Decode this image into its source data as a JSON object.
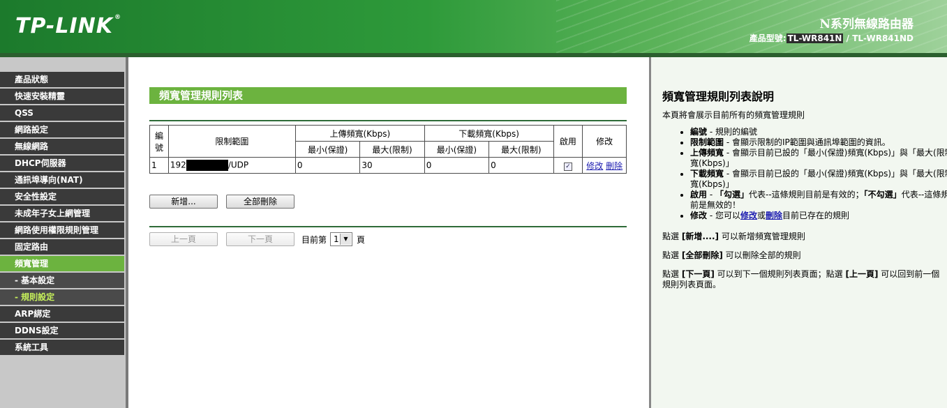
{
  "header": {
    "logo": "TP-LINK",
    "logo_mark": "®",
    "title": "N系列無線路由器",
    "model_label": "產品型號:",
    "model_primary": "TL-WR841N",
    "model_secondary": " / TL-WR841ND"
  },
  "sidebar": {
    "items": [
      {
        "label": "產品狀態"
      },
      {
        "label": "快速安裝精靈"
      },
      {
        "label": "QSS"
      },
      {
        "label": "網路設定"
      },
      {
        "label": "無線網路"
      },
      {
        "label": "DHCP伺服器"
      },
      {
        "label": "通訊埠導向(NAT)"
      },
      {
        "label": "安全性設定"
      },
      {
        "label": "未成年子女上網管理"
      },
      {
        "label": "網路使用權限規則管理"
      },
      {
        "label": "固定路由"
      },
      {
        "label": "頻寬管理"
      },
      {
        "label": "- 基本設定"
      },
      {
        "label": "- 規則設定"
      },
      {
        "label": "ARP綁定"
      },
      {
        "label": "DDNS設定"
      },
      {
        "label": "系統工具"
      }
    ]
  },
  "main": {
    "title": "頻寬管理規則列表",
    "table": {
      "h_no": "編號",
      "h_range": "限制範圍",
      "h_up": "上傳頻寬(Kbps)",
      "h_down": "下載頻寬(Kbps)",
      "h_enable": "啟用",
      "h_modify": "修改",
      "h_min": "最小(保證)",
      "h_max": "最大(限制)",
      "row": {
        "no": "1",
        "range_prefix": "192",
        "range_suffix": "/UDP",
        "up_min": "0",
        "up_max": "30",
        "down_min": "0",
        "down_max": "0",
        "enabled": true,
        "edit": "修改",
        "delete": "刪除"
      }
    },
    "add_button": "新增...",
    "delete_all_button": "全部刪除",
    "prev_button": "上一頁",
    "next_button": "下一頁",
    "page_prefix": "目前第",
    "page_value": "1",
    "page_suffix": "頁"
  },
  "help": {
    "title": "頻寬管理規則列表說明",
    "intro": "本頁將會展示目前所有的頻寬管理規則",
    "items": [
      {
        "term": "編號",
        "desc": " - 規則的編號"
      },
      {
        "term": "限制範圍",
        "desc": " - 會顯示限制的IP範圍與通訊埠範圍的資訊。"
      },
      {
        "term": "上傳頻寬",
        "desc": " - 會顯示目前已設的「最小(保證)頻寬(Kbps)」與「最大(限制)頻寬(Kbps)」"
      },
      {
        "term": "下載頻寬",
        "desc": " - 會顯示目前已設的「最小(保證)頻寬(Kbps)」與「最大(限制)頻寬(Kbps)」"
      }
    ],
    "enable_term": "啟用",
    "enable_desc_a": " - ",
    "enable_checked": "「勾選」",
    "enable_desc_b": "代表--這條規則目前是有效的；",
    "enable_unchecked": "「不勾選」",
    "enable_desc_c": "代表--這條規則目前是無效的！",
    "modify_term": "修改",
    "modify_desc_a": " - 您可以",
    "modify_link1": "修改",
    "modify_or": "或",
    "modify_link2": "刪除",
    "modify_desc_b": "目前已存在的規則",
    "p1_prefix": "點選 ",
    "p1_bold": "[新增....]",
    "p1_text": " 可以新增頻寬管理規則",
    "p2_prefix": "點選 ",
    "p2_bold": "[全部刪除]",
    "p2_text": " 可以刪除全部的規則",
    "p3_prefix": "點選 ",
    "p3_bold1": "[下一頁]",
    "p3_mid": " 可以到下一個規則列表頁面；點選 ",
    "p3_bold2": "[上一頁]",
    "p3_text": " 可以回到前一個規則列表頁面。"
  }
}
